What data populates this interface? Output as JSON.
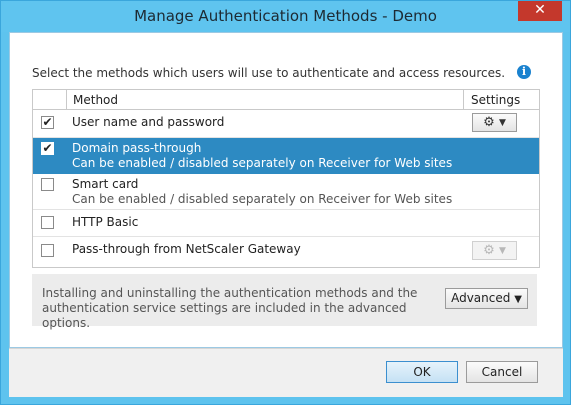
{
  "window": {
    "title": "Manage Authentication Methods - Demo",
    "close_glyph": "✕"
  },
  "intro_text": "Select the methods which users will use to authenticate and access resources.",
  "info_icon_glyph": "i",
  "table": {
    "headers": {
      "method": "Method",
      "settings": "Settings"
    },
    "rows": [
      {
        "label": "User name and password",
        "sub": "",
        "checked": true,
        "selected": false,
        "settings": "enabled"
      },
      {
        "label": "Domain pass-through",
        "sub": "Can be enabled / disabled separately on Receiver for Web sites",
        "checked": true,
        "selected": true,
        "settings": "none"
      },
      {
        "label": "Smart card",
        "sub": "Can be enabled / disabled separately on Receiver for Web sites",
        "checked": false,
        "selected": false,
        "settings": "none"
      },
      {
        "label": "HTTP Basic",
        "sub": "",
        "checked": false,
        "selected": false,
        "settings": "none"
      },
      {
        "label": "Pass-through from NetScaler Gateway",
        "sub": "",
        "checked": false,
        "selected": false,
        "settings": "disabled"
      }
    ],
    "check_glyph": "✔",
    "gear_glyph": "⚙",
    "dropdown_glyph": "▼"
  },
  "advanced": {
    "text": "Installing and uninstalling the authentication methods and the authentication service settings are included in the advanced options.",
    "button_label": "Advanced",
    "button_glyph": "▼"
  },
  "buttons": {
    "ok": "OK",
    "cancel": "Cancel"
  },
  "colors": {
    "titlebar": "#5fc4ef",
    "selection": "#2d8ac2",
    "close": "#c4382c",
    "info": "#1a82cf"
  }
}
